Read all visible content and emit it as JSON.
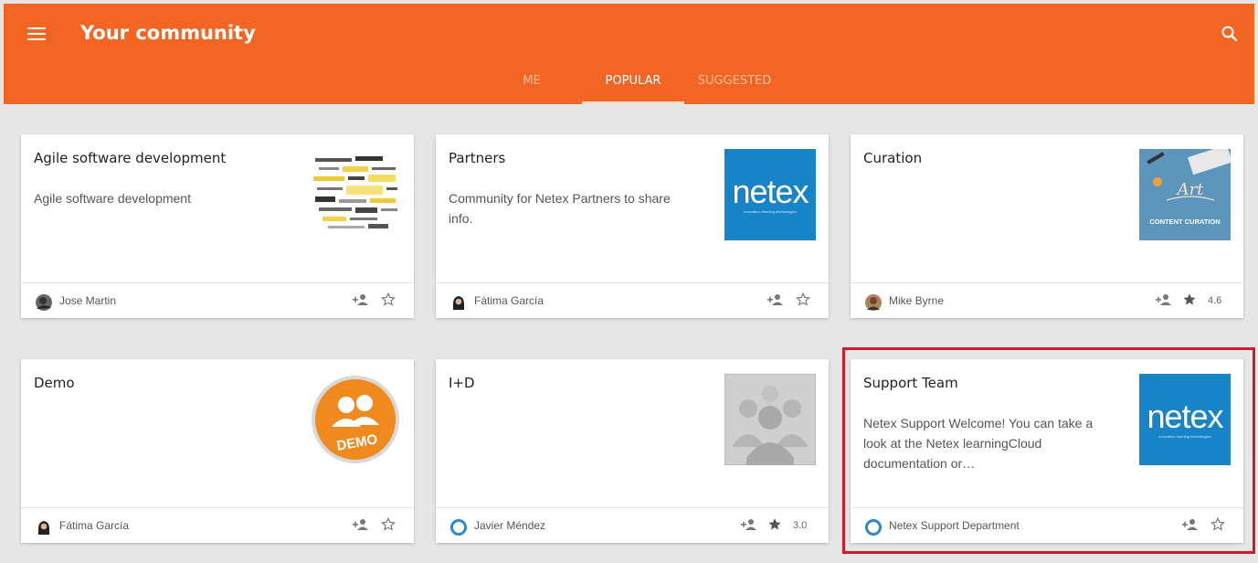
{
  "app": {
    "title": "Your community"
  },
  "tabs": [
    {
      "label": "ME",
      "active": false
    },
    {
      "label": "POPULAR",
      "active": true
    },
    {
      "label": "SUGGESTED",
      "active": false
    }
  ],
  "colors": {
    "brand": "#f26522",
    "netex_blue": "#1784c8",
    "highlight": "#d01c2a"
  },
  "cards": [
    {
      "title": "Agile software development",
      "description": "Agile software development",
      "owner": "Jose Martin",
      "rating": "",
      "thumb": "wordcloud-image"
    },
    {
      "title": "Partners",
      "description": "Community for Netex Partners to share info.",
      "owner": "Fátima García",
      "rating": "",
      "thumb": "netex-logo"
    },
    {
      "title": "Curation",
      "description": "",
      "owner": "Mike Byrne",
      "rating": "4.6",
      "thumb": "content-curation-image",
      "thumb_text": "CONTENT CURATION"
    },
    {
      "title": "Demo",
      "description": "",
      "owner": "Fátima García",
      "rating": "",
      "thumb": "demo-badge",
      "thumb_text": "DEMO"
    },
    {
      "title": "I+D",
      "description": "",
      "owner": "Javier Méndez",
      "rating": "3.0",
      "thumb": "group-placeholder-image"
    },
    {
      "title": "Support Team",
      "description": "Netex Support Welcome! You can take a look at the Netex learningCloud documentation or…",
      "owner": "Netex Support Department",
      "rating": "",
      "thumb": "netex-logo"
    }
  ],
  "netex_logo": {
    "word": "netex",
    "tagline": "innovation learning technologies"
  }
}
